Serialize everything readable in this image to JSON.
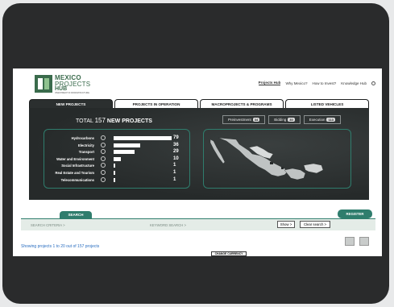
{
  "logo": {
    "line1": "MEXICO",
    "line2": "PROJECTS",
    "line3": "HUB",
    "tagline": "INVESTMENT IN INFRASTRUCTURE"
  },
  "nav": {
    "items": [
      "Projects Hub",
      "Why Mexico?",
      "How to Invest?",
      "Knowledge Hub"
    ],
    "active": "Projects Hub"
  },
  "tabs": [
    "NEW PROJECTS",
    "PROJECTS IN OPERATION",
    "MACROPROJECTS & PROGRAMS",
    "LISTED VEHICLES"
  ],
  "summary": {
    "prefix": "TOTAL",
    "count": "157",
    "suffix": "NEW PROJECTS"
  },
  "stages": [
    {
      "label": "Preinvestment",
      "count": "34"
    },
    {
      "label": "Bidding",
      "count": "30"
    },
    {
      "label": "Execution",
      "count": "113"
    }
  ],
  "sectors": [
    {
      "label": "Hydrocarbons",
      "value": 79
    },
    {
      "label": "Electricity",
      "value": 36
    },
    {
      "label": "Transport",
      "value": 29
    },
    {
      "label": "Water and Environment",
      "value": 10
    },
    {
      "label": "Social Infrastructure",
      "value": 1
    },
    {
      "label": "Real Estate and Tourism",
      "value": 1
    },
    {
      "label": "Telecommunications",
      "value": 1
    }
  ],
  "search": {
    "tab_label": "SEARCH",
    "register_label": "REGISTER",
    "criteria_label": "SEARCH CRITERIA >",
    "keyword_label": "KEYWORD SEARCH >",
    "show_label": "Show >",
    "clear_label": "Clear search >"
  },
  "results": {
    "showing_text": "Showing projects 1 to 20 out of 157 projects"
  },
  "currency_label": "CHANGE CURRENCY",
  "colors": {
    "accent": "#2f7d6d",
    "panel": "#262a2a",
    "link": "#2a6ec0"
  }
}
